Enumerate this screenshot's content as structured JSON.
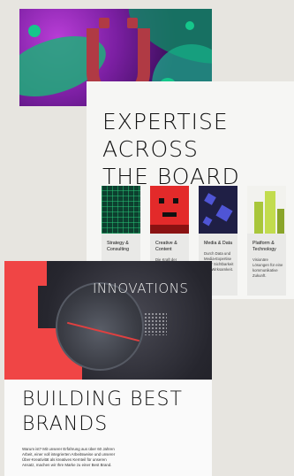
{
  "top_artwork": {
    "letter": "Ü"
  },
  "middle_card": {
    "headline_line1": "EXPERTISE ACROSS",
    "headline_line2": "THE BOARD",
    "tiles": [
      {
        "title": "Strategy & Consulting",
        "text": ""
      },
      {
        "title": "Creative & Content",
        "text": "Die Kraft der Kreativität..."
      },
      {
        "title": "Media & Data",
        "text": "Durch Data und Media-Expertise mehr Sichtbarkeit und Wirksamkeit."
      },
      {
        "title": "Platform & Technology",
        "text": "Visionäre Lösungen für eine kommunikative Zukunft."
      }
    ]
  },
  "bottom_card": {
    "overlay_word": "INNOVATIONS",
    "headline_line1": "BUILDING BEST",
    "headline_line2": "BRANDS",
    "body": "Warum ist? Mit unserer Erfahrung aus über 60 Jahren Arbeit, einer voll integrierten Arbeitsweise und unserer Über-Kreativität als kreatives Kernteil für unseren Ansatz, machen wir Ihre Marke zu einer Best Brand."
  },
  "colors": {
    "background": "#e7e5e0",
    "accent_red": "#f04545",
    "accent_green": "#a8c63a"
  }
}
